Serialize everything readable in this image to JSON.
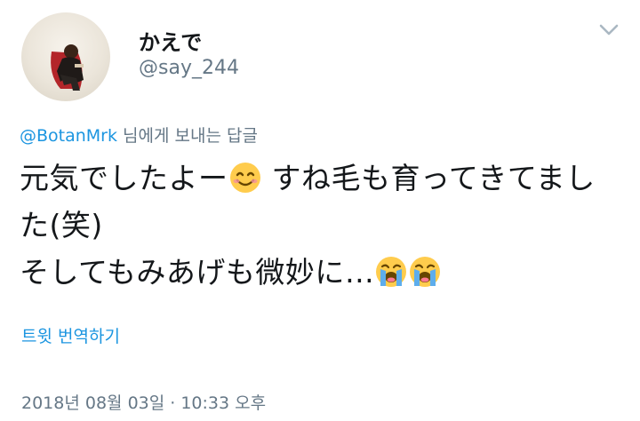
{
  "author": {
    "display_name": "かえで",
    "handle": "@say_244"
  },
  "menu": {
    "icon": "chevron-down-icon"
  },
  "reply_context": {
    "mention": "@BotanMrk",
    "suffix": " 님에게 보내는 답글"
  },
  "tweet": {
    "line1": "元気でしたよー",
    "line1_after_emoji": " すね毛も育ってきてまし",
    "line2": "た(笑)",
    "line3": "そしてもみあげも微妙に…",
    "emojis": [
      "smiling-face-emoji",
      "loudly-crying-face-emoji",
      "loudly-crying-face-emoji"
    ]
  },
  "translate_label": "트윗 번역하기",
  "timestamp": "2018년 08월 03일 · 10:33 오후",
  "colors": {
    "link": "#1b95e0",
    "secondary_text": "#657786",
    "primary_text": "#14171a"
  }
}
